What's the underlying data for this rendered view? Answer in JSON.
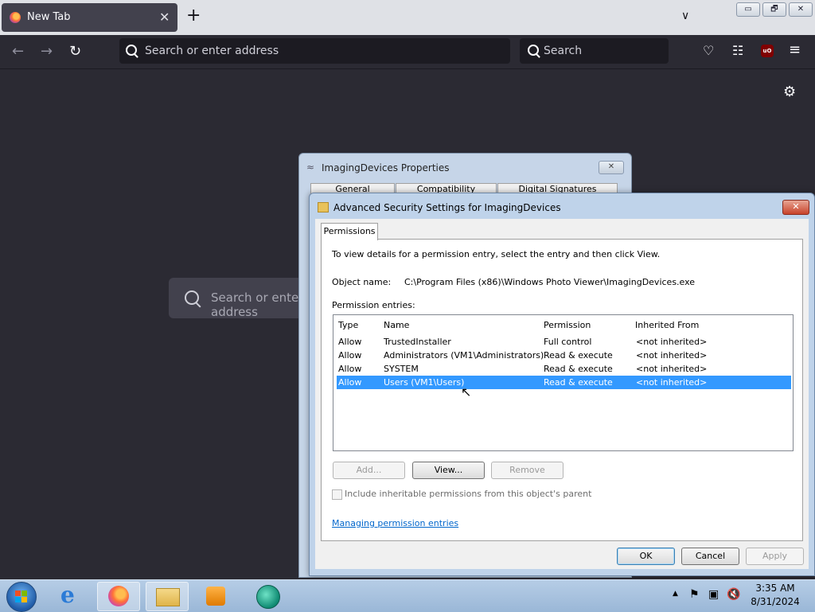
{
  "browser": {
    "tab_title": "New Tab",
    "tab_close": "✕",
    "new_tab": "+",
    "address_placeholder": "Search or enter address",
    "search_placeholder": "Search",
    "ublock_label": "uO",
    "newtab_search_placeholder": "Search or enter address",
    "window_controls": {
      "minimize": "▭",
      "restore": "🗗",
      "close": "✕"
    }
  },
  "props_window": {
    "title": "ImagingDevices Properties",
    "close": "✕",
    "tabs": [
      "General",
      "Compatibility",
      "Digital Signatures"
    ]
  },
  "adv_window": {
    "title": "Advanced Security Settings for ImagingDevices",
    "close": "✕",
    "tab": "Permissions",
    "instructions": "To view details for a permission entry, select the entry and then click View.",
    "object_name_label": "Object name:",
    "object_name_value": "C:\\Program Files (x86)\\Windows Photo Viewer\\ImagingDevices.exe",
    "entries_label": "Permission entries:",
    "columns": [
      "Type",
      "Name",
      "Permission",
      "Inherited From"
    ],
    "rows": [
      {
        "type": "Allow",
        "name": "TrustedInstaller",
        "permission": "Full control",
        "inherited": "<not inherited>"
      },
      {
        "type": "Allow",
        "name": "Administrators (VM1\\Administrators)",
        "permission": "Read & execute",
        "inherited": "<not inherited>"
      },
      {
        "type": "Allow",
        "name": "SYSTEM",
        "permission": "Read & execute",
        "inherited": "<not inherited>"
      },
      {
        "type": "Allow",
        "name": "Users (VM1\\Users)",
        "permission": "Read & execute",
        "inherited": "<not inherited>"
      }
    ],
    "selected_row": 3,
    "add_button": "Add...",
    "view_button": "View...",
    "remove_button": "Remove",
    "include_inheritable": "Include inheritable permissions from this object's parent",
    "link": "Managing permission entries",
    "ok": "OK",
    "cancel": "Cancel",
    "apply": "Apply"
  },
  "taskbar": {
    "time": "3:35 AM",
    "date": "8/31/2024",
    "tray_expand": "▲"
  },
  "colors": {
    "selection": "#3399ff",
    "firefox_bg": "#2b2a33",
    "link": "#0066cc"
  }
}
